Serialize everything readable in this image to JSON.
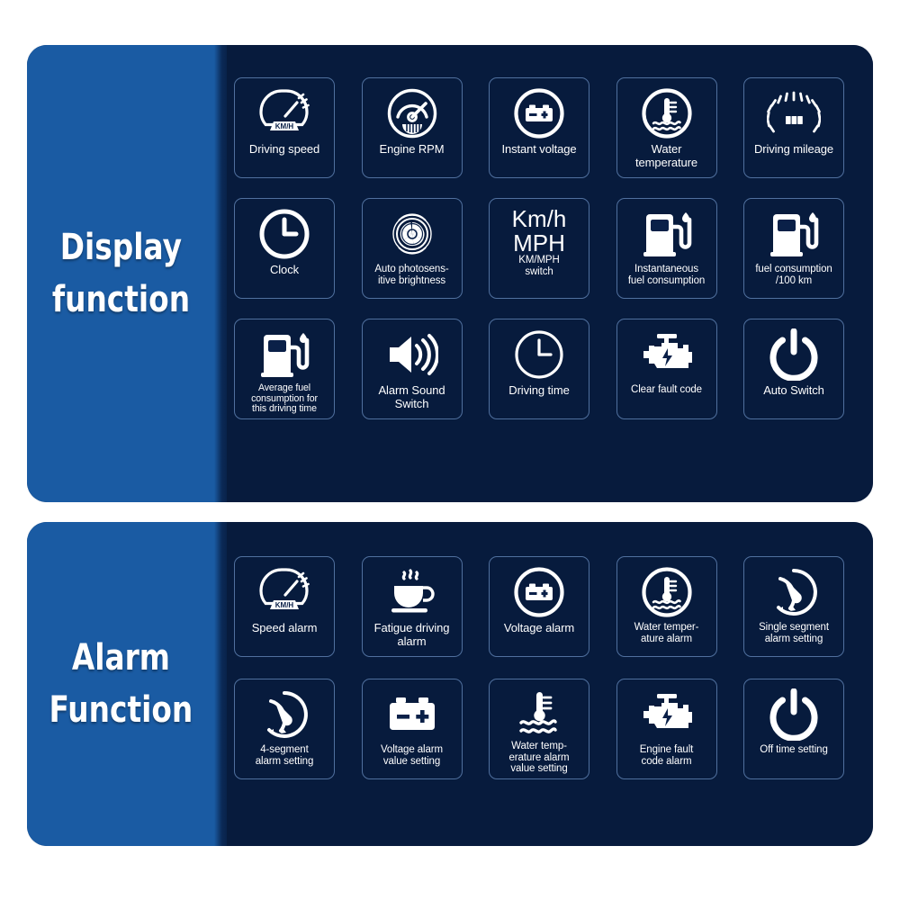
{
  "sections": [
    {
      "id": "display-function",
      "title_lines": [
        "Display",
        "function"
      ],
      "rows": [
        [
          {
            "icon": "speedometer-kmh-icon",
            "label": "Driving speed",
            "size": "m"
          },
          {
            "icon": "engine-rpm-gauge-icon",
            "label": "Engine RPM",
            "size": "m"
          },
          {
            "icon": "battery-circle-icon",
            "label": "Instant voltage",
            "size": "m"
          },
          {
            "icon": "water-temperature-circle-icon",
            "label": "Water\ntemperature",
            "size": "m"
          },
          {
            "icon": "odometer-icon",
            "label": "Driving mileage",
            "size": "m"
          }
        ],
        [
          {
            "icon": "clock-icon",
            "label": "Clock",
            "size": "m"
          },
          {
            "icon": "photosensor-iris-icon",
            "label": "Auto photosens-\nitive brightness",
            "size": "s"
          },
          {
            "icon": "kmh-mph-text-icon",
            "big_text": "Km/h\nMPH",
            "label": "KM/MPH\nswitch",
            "size": "s"
          },
          {
            "icon": "fuel-pump-icon",
            "label": "Instantaneous\nfuel consumption",
            "size": "s"
          },
          {
            "icon": "fuel-pump-icon",
            "label": "fuel consumption\n/100 km",
            "size": "s"
          }
        ],
        [
          {
            "icon": "fuel-pump-icon",
            "label": "Average fuel\nconsumption for\nthis driving time",
            "size": "xs"
          },
          {
            "icon": "speaker-alarm-icon",
            "label": "Alarm Sound\nSwitch",
            "size": "m"
          },
          {
            "icon": "driving-time-clock-icon",
            "label": "Driving time",
            "size": "m"
          },
          {
            "icon": "engine-fault-icon",
            "label": "Clear fault code",
            "size": "s"
          },
          {
            "icon": "power-switch-icon",
            "label": "Auto Switch",
            "size": "m"
          }
        ]
      ]
    },
    {
      "id": "alarm-function",
      "title_lines": [
        "Alarm",
        "Function"
      ],
      "rows": [
        [
          {
            "icon": "speedometer-kmh-icon",
            "label": "Speed alarm",
            "size": "m"
          },
          {
            "icon": "coffee-cup-icon",
            "label": "Fatigue driving\nalarm",
            "size": "m"
          },
          {
            "icon": "battery-circle-icon",
            "label": "Voltage alarm",
            "size": "m"
          },
          {
            "icon": "water-temperature-circle-icon",
            "label": "Water temper-\nature alarm",
            "size": "s"
          },
          {
            "icon": "single-segment-gauge-icon",
            "label": "Single segment\nalarm setting",
            "size": "s"
          }
        ],
        [
          {
            "icon": "single-segment-gauge-icon",
            "label": "4-segment\nalarm setting",
            "size": "s"
          },
          {
            "icon": "battery-plain-icon",
            "label": "Voltage alarm\nvalue setting",
            "size": "s"
          },
          {
            "icon": "water-temperature-plain-icon",
            "label": "Water temp-\nerature alarm\nvalue setting",
            "size": "s"
          },
          {
            "icon": "engine-fault-icon",
            "label": "Engine fault\ncode alarm",
            "size": "s"
          },
          {
            "icon": "power-switch-icon",
            "label": "Off time setting",
            "size": "s"
          }
        ]
      ]
    }
  ],
  "colors": {
    "sidebar_blue": "#1a5ba3",
    "panel_navy": "#071b3d",
    "tile_border": "#50709e",
    "text_white": "#ffffff",
    "page_background": "#ffffff"
  }
}
